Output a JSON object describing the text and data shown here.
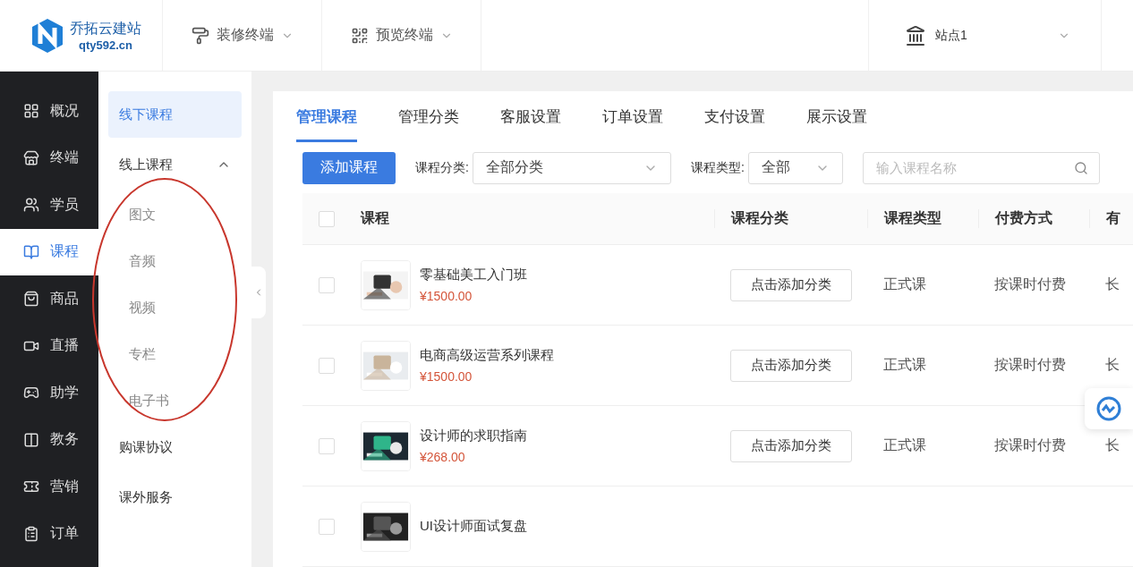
{
  "header": {
    "logo": {
      "name": "乔拓云建站",
      "domain": "qty592.cn"
    },
    "menus": [
      {
        "label": "装修终端"
      },
      {
        "label": "预览终端"
      }
    ],
    "site": {
      "label": "站点1"
    }
  },
  "nav": [
    {
      "label": "概况",
      "selected": false
    },
    {
      "label": "终端",
      "selected": false
    },
    {
      "label": "学员",
      "selected": false
    },
    {
      "label": "课程",
      "selected": true
    },
    {
      "label": "商品",
      "selected": false
    },
    {
      "label": "直播",
      "selected": false
    },
    {
      "label": "助学",
      "selected": false
    },
    {
      "label": "教务",
      "selected": false
    },
    {
      "label": "营销",
      "selected": false
    },
    {
      "label": "订单",
      "selected": false
    }
  ],
  "subnav": [
    {
      "label": "线下课程",
      "selected": true
    },
    {
      "label": "线上课程",
      "selected": false,
      "expanded": true,
      "children": [
        {
          "label": "图文",
          "selected": false
        },
        {
          "label": "音频",
          "selected": false
        },
        {
          "label": "视频",
          "selected": false
        },
        {
          "label": "专栏",
          "selected": false
        },
        {
          "label": "电子书",
          "selected": false
        }
      ]
    },
    {
      "label": "购课协议",
      "selected": false
    },
    {
      "label": "课外服务",
      "selected": false
    }
  ],
  "annotation": {
    "kind": "ellipse"
  },
  "tabs": [
    {
      "label": "管理课程",
      "selected": true
    },
    {
      "label": "管理分类",
      "selected": false
    },
    {
      "label": "客服设置",
      "selected": false
    },
    {
      "label": "订单设置",
      "selected": false
    },
    {
      "label": "支付设置",
      "selected": false
    },
    {
      "label": "展示设置",
      "selected": false
    }
  ],
  "toolbar": {
    "add_button": "添加课程",
    "category_label": "课程分类:",
    "category_value": "全部分类",
    "type_label": "课程类型:",
    "type_value": "全部",
    "search": {
      "placeholder": "输入课程名称"
    }
  },
  "table": {
    "all_checked": false,
    "columns": [
      "课程",
      "课程分类",
      "课程类型",
      "付费方式",
      "有"
    ],
    "rows": [
      {
        "checked": false,
        "title": "零基础美工入门班",
        "price": "¥1500.00",
        "category_button": "点击添加分类",
        "type": "正式课",
        "payment": "按课时付费",
        "column_5": "长"
      },
      {
        "checked": false,
        "title": "电商高级运营系列课程",
        "price": "¥1500.00",
        "category_button": "点击添加分类",
        "type": "正式课",
        "payment": "按课时付费",
        "column_5": "长"
      },
      {
        "checked": false,
        "title": "设计师的求职指南",
        "price": "¥268.00",
        "category_button": "点击添加分类",
        "type": "正式课",
        "payment": "按课时付费",
        "column_5": "长"
      },
      {
        "checked": false,
        "title": "UI设计师面试复盘"
      }
    ]
  }
}
